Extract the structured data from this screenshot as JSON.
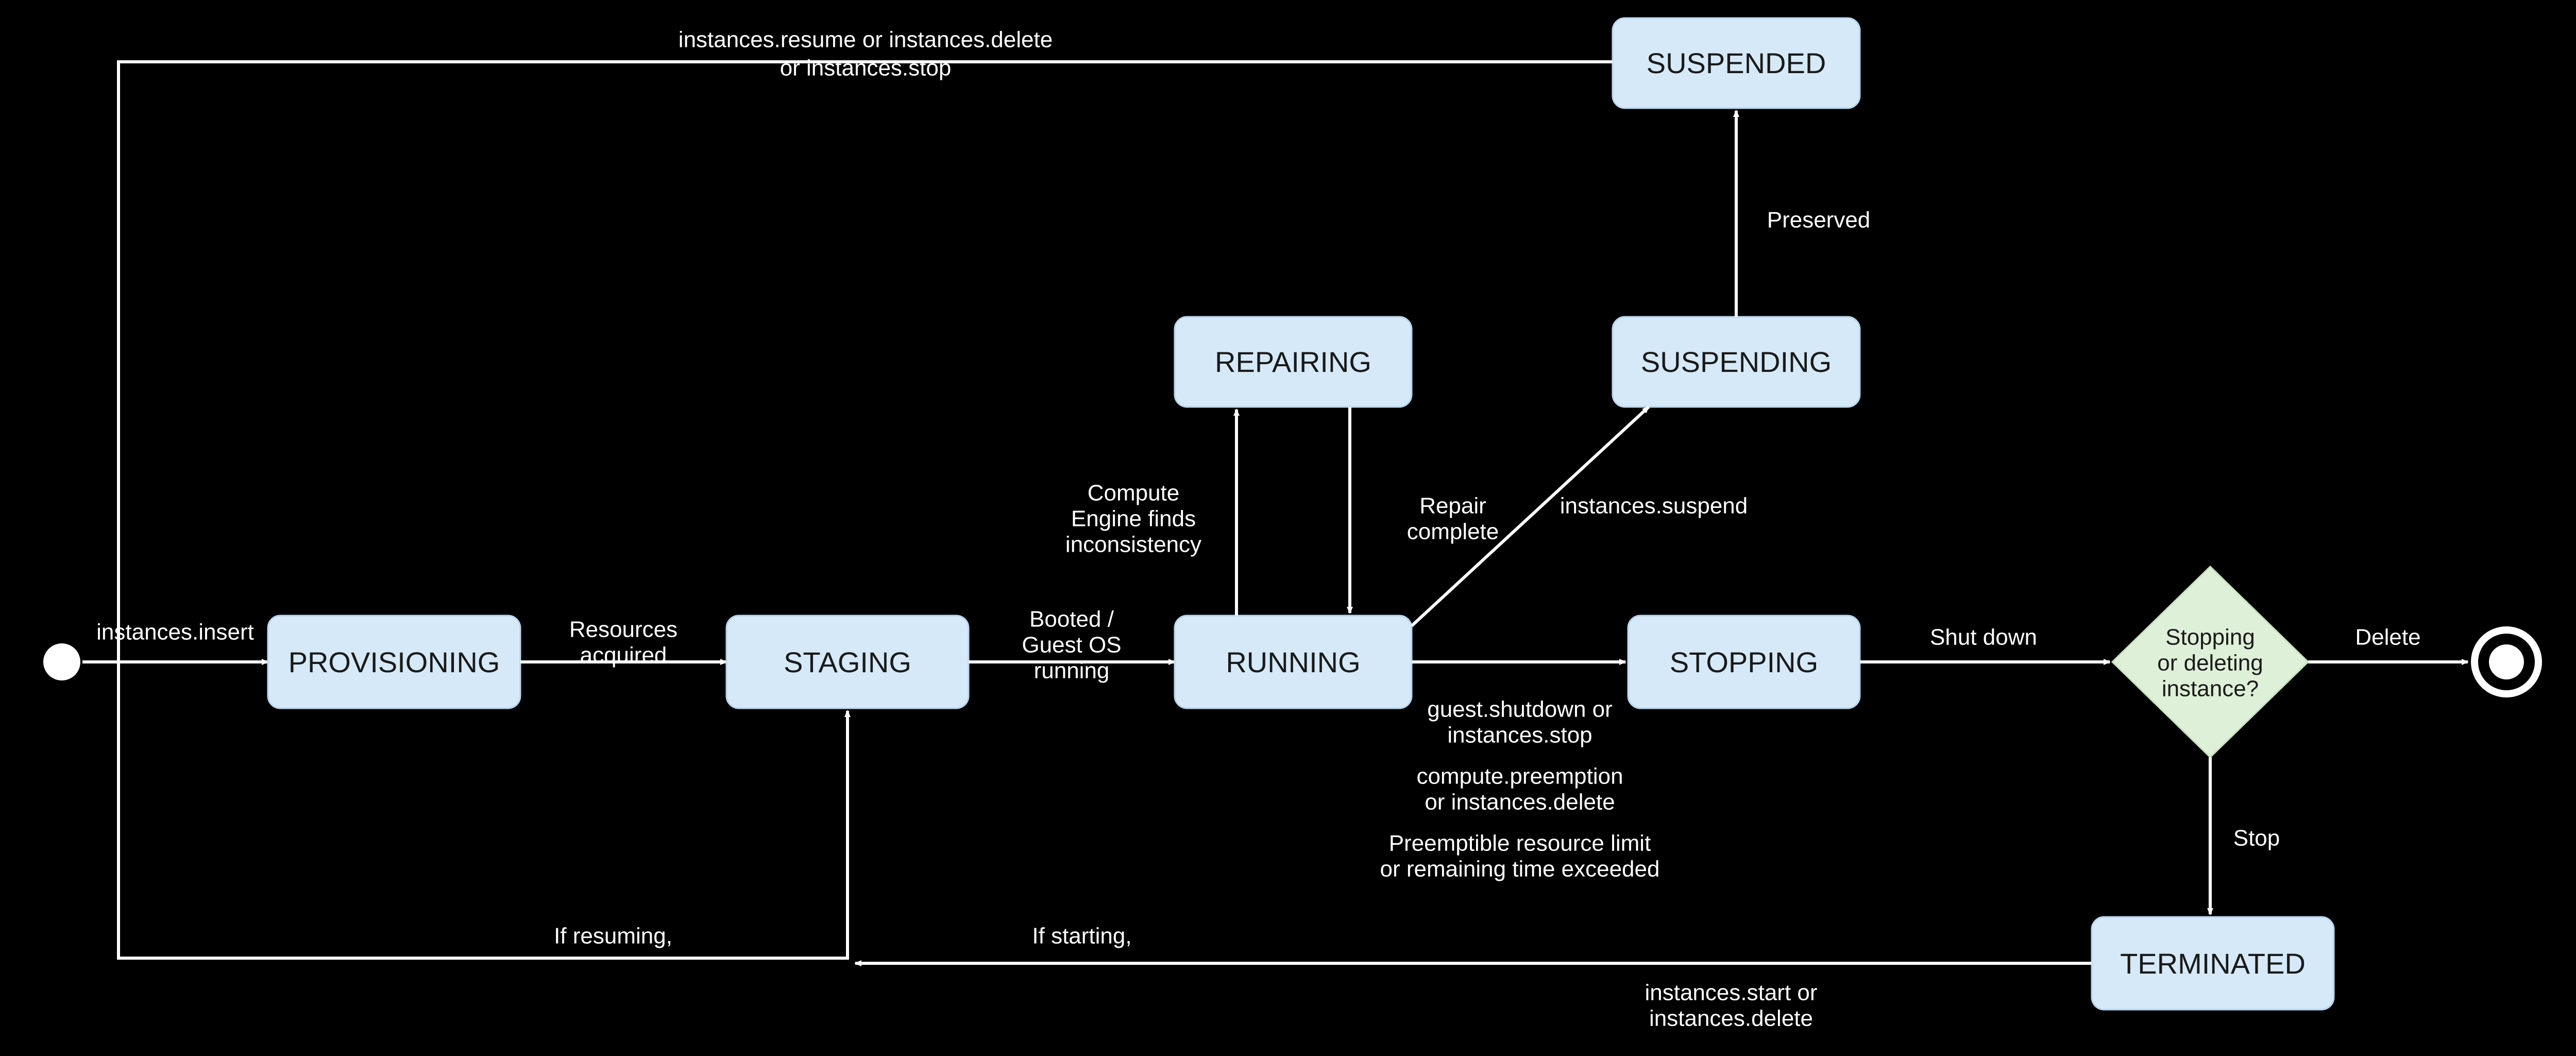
{
  "states": {
    "provisioning": "PROVISIONING",
    "staging": "STAGING",
    "running": "RUNNING",
    "repairing": "REPAIRING",
    "suspending": "SUSPENDING",
    "suspended": "SUSPENDED",
    "stopping": "STOPPING",
    "terminated": "TERMINATED"
  },
  "decision": {
    "line1": "Stopping",
    "line2": "or deleting",
    "line3": "instance?"
  },
  "edges": {
    "start_to_provisioning": "instances.insert",
    "provisioning_to_staging": "Resources acquired",
    "staging_to_running": "Booted / Guest OS running",
    "running_to_repairing_up": "Compute Engine finds inconsistency",
    "repairing_to_running_down": "Repair complete",
    "running_to_suspending": "instances.suspend",
    "suspending_to_suspended": "Preserved",
    "suspended_back": "instances.resume or instances.delete or instances.stop",
    "suspended_back_to_staging_wrap": "If resuming,",
    "running_to_stopping_top": "guest.shutdown or instances.stop",
    "running_to_stopping_mid": "compute.preemption or instances.delete",
    "running_to_stopping_bot": "Preemptible resource limit or remaining time exceeded",
    "stopping_to_decision": "Shut down",
    "decision_to_terminal": "Delete",
    "decision_to_terminated": "Stop",
    "terminated_back_top": "instances.start or instances.delete",
    "terminated_back_mid": "If starting,"
  },
  "colors": {
    "state_fill": "#d6e9f8",
    "state_stroke": "#b7d4ec",
    "decision_fill": "#dff0d8",
    "decision_stroke": "#c9e2c1",
    "background": "#000000",
    "line": "#ffffff"
  }
}
